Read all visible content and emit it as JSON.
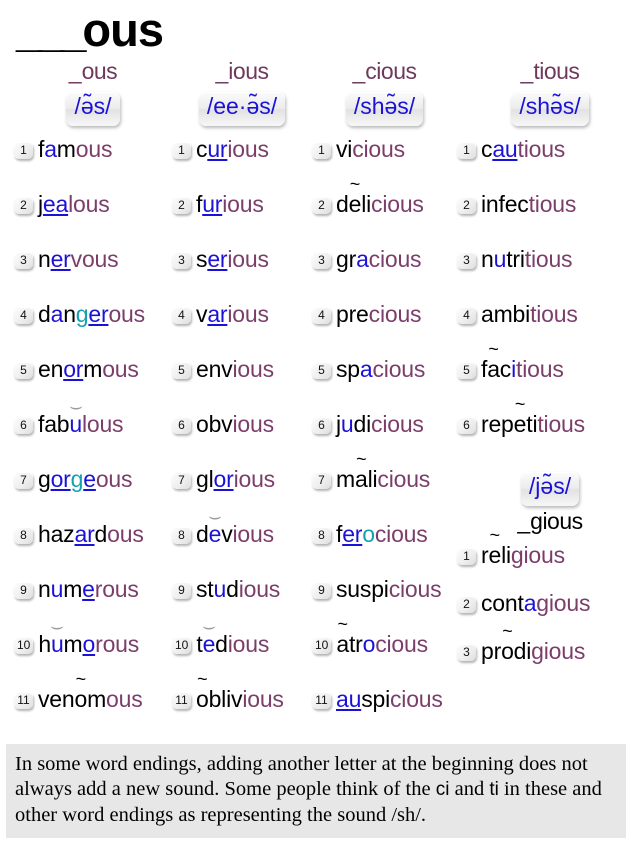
{
  "title": {
    "blank": "___",
    "suffix": "ous"
  },
  "columns": [
    {
      "id": "ous",
      "heading_blank": "_",
      "heading_suffix": "ous",
      "phonetic": "/ə̃s/",
      "words": [
        {
          "n": "1",
          "text": "famous"
        },
        {
          "n": "2",
          "text": "jealous"
        },
        {
          "n": "3",
          "text": "nervous"
        },
        {
          "n": "4",
          "text": "dangerous"
        },
        {
          "n": "5",
          "text": "enormous"
        },
        {
          "n": "6",
          "text": "fabulous"
        },
        {
          "n": "7",
          "text": "gorgeous"
        },
        {
          "n": "8",
          "text": "hazardous"
        },
        {
          "n": "9",
          "text": "numerous"
        },
        {
          "n": "10",
          "text": "humorous"
        },
        {
          "n": "11",
          "text": "venomous"
        }
      ]
    },
    {
      "id": "ious",
      "heading_blank": "_",
      "heading_suffix": "ious",
      "phonetic": "/ee·ə̃s/",
      "words": [
        {
          "n": "1",
          "text": "curious"
        },
        {
          "n": "2",
          "text": "furious"
        },
        {
          "n": "3",
          "text": "serious"
        },
        {
          "n": "4",
          "text": "various"
        },
        {
          "n": "5",
          "text": "envious"
        },
        {
          "n": "6",
          "text": "obvious"
        },
        {
          "n": "7",
          "text": "glorious"
        },
        {
          "n": "8",
          "text": "devious"
        },
        {
          "n": "9",
          "text": "studious"
        },
        {
          "n": "10",
          "text": "tedious"
        },
        {
          "n": "11",
          "text": "oblivious"
        }
      ]
    },
    {
      "id": "cious",
      "heading_blank": "_",
      "heading_suffix": "cious",
      "phonetic": "/shə̃s/",
      "words": [
        {
          "n": "1",
          "text": "vicious"
        },
        {
          "n": "2",
          "text": "delicious"
        },
        {
          "n": "3",
          "text": "gracious"
        },
        {
          "n": "4",
          "text": "precious"
        },
        {
          "n": "5",
          "text": "spacious"
        },
        {
          "n": "6",
          "text": "judicious"
        },
        {
          "n": "7",
          "text": "malicious"
        },
        {
          "n": "8",
          "text": "ferocious"
        },
        {
          "n": "9",
          "text": "suspicious"
        },
        {
          "n": "10",
          "text": "atrocious"
        },
        {
          "n": "11",
          "text": "auspicious"
        }
      ]
    },
    {
      "id": "tious",
      "heading_blank": "_",
      "heading_suffix": "tious",
      "phonetic": "/shə̃s/",
      "words": [
        {
          "n": "1",
          "text": "cautious"
        },
        {
          "n": "2",
          "text": "infectious"
        },
        {
          "n": "3",
          "text": "nutritious"
        },
        {
          "n": "4",
          "text": "ambitious"
        },
        {
          "n": "5",
          "text": "facitious"
        },
        {
          "n": "6",
          "text": "repetitious"
        }
      ]
    }
  ],
  "sub_group": {
    "id": "gious",
    "phonetic": "/jə̃s/",
    "heading_blank": "_",
    "heading_suffix": "gious",
    "words": [
      {
        "n": "1",
        "text": "religious"
      },
      {
        "n": "2",
        "text": "contagious"
      },
      {
        "n": "3",
        "text": "prodigious"
      }
    ]
  },
  "footer": {
    "text": "In some word endings, adding another letter at the beginning does not always add a new sound. Some people think of the ci and ti in these and other word endings as representing the sound /sh/."
  },
  "colors": {
    "heading": "#6d3a5e",
    "phonetic_text": "#1b12d8",
    "suffix_purple": "#7b3e6b",
    "vowel_blue": "#1b12d8",
    "soft_teal": "#13a3ae",
    "footer_bg": "#e7e7e7"
  },
  "word_markup": {
    "famous": "<span class='b'>f</span><span class='bl'>a</span><span class='b'>m</span><span class='pu'>ous</span>",
    "jealous": "<span class='b'>j</span><span class='bl u'>ea</span><span class='pu'>lous</span>",
    "nervous": "<span class='b'>n</span><span class='bl u'>er</span><span class='pu'>vous</span>",
    "dangerous": "<span class='b'>d</span><span class='bl'>a</span><span class='b'>n</span><span class='tl'>g</span><span class='bl u'>er</span><span class='pu'>ous</span>",
    "enormous": "<span class='b'>en</span><span class='bl u'>or</span><span class='b'>m</span><span class='pu'>ous</span>",
    "fabulous": "<span class='b'>fab</span><span class='bl br'>u</span><span class='pu'>lous</span>",
    "gorgeous": "<span class='b'>g</span><span class='bl u'>or</span><span class='tl u'>g</span><span class='bl u'>e</span><span class='pu'>ous</span>",
    "hazardous": "<span class='b'>haz</span><span class='bl u'>ar</span><span class='b'>d</span><span class='pu'>ous</span>",
    "numerous": "<span class='b'>n</span><span class='bl'>u</span><span class='b'>m</span><span class='bl u'>e</span><span class='pu'>rous</span>",
    "humorous": "<span class='b'>h</span><span class='bl br'>u</span><span class='b'>m</span><span class='bl u'>o</span><span class='pu'>rous</span>",
    "venomous": "<span class='b'>ven</span><span class='b tilde'>o</span><span class='b'>m</span><span class='pu'>ous</span>",
    "curious": "<span class='b'>c</span><span class='bl u'>ur</span><span class='pu'>ious</span>",
    "furious": "<span class='b'>f</span><span class='bl u'>ur</span><span class='pu'>ious</span>",
    "serious": "<span class='b'>s</span><span class='bl u'>er</span><span class='pu'>ious</span>",
    "various": "<span class='b'>v</span><span class='bl u'>ar</span><span class='pu'>ious</span>",
    "envious": "<span class='b'>env</span><span class='pu'>ious</span>",
    "obvious": "<span class='b'>obv</span><span class='pu'>ious</span>",
    "glorious": "<span class='b'>gl</span><span class='bl u'>or</span><span class='pu'>ious</span>",
    "devious": "<span class='b'>d</span><span class='bl br'>e</span><span class='b'>v</span><span class='pu'>ious</span>",
    "studious": "<span class='b'>st</span><span class='bl'>u</span><span class='b'>d</span><span class='pu'>ious</span>",
    "tedious": "<span class='b'>t</span><span class='bl br'>e</span><span class='b'>d</span><span class='pu'>ious</span>",
    "oblivious": "<span class='b tilde'>o</span><span class='b'>bliv</span><span class='pu'>ious</span>",
    "vicious": "<span class='b'>vi</span><span class='pu'>cious</span>",
    "delicious": "<span class='b'>d</span><span class='b tilde'>e</span><span class='b'>li</span><span class='pu'>cious</span>",
    "gracious": "<span class='b'>gr</span><span class='bl'>a</span><span class='pu'>cious</span>",
    "precious": "<span class='b'>pre</span><span class='pu'>cious</span>",
    "spacious": "<span class='b'>sp</span><span class='bl'>a</span><span class='pu'>cious</span>",
    "judicious": "<span class='b'>j</span><span class='bl'>u</span><span class='b'>di</span><span class='pu'>cious</span>",
    "malicious": "<span class='b'>m</span><span class='b tilde'>a</span><span class='b'>li</span><span class='pu'>cious</span>",
    "ferocious": "<span class='b'>f</span><span class='bl u'>er</span><span class='tl'>o</span><span class='pu'>cious</span>",
    "suspicious": "<span class='b'>suspi</span><span class='pu'>cious</span>",
    "atrocious": "<span class='b tilde'>a</span><span class='b'>tr</span><span class='bl'>o</span><span class='pu'>cious</span>",
    "auspicious": "<span class='bl u'>au</span><span class='b'>spi</span><span class='pu'>cious</span>",
    "cautious": "<span class='b'>c</span><span class='bl u'>au</span><span class='pu'>tious</span>",
    "infectious": "<span class='b'>infec</span><span class='pu'>tious</span>",
    "nutritious": "<span class='b'>n</span><span class='bl'>u</span><span class='b'>tri</span><span class='pu'>tious</span>",
    "ambitious": "<span class='b'>ambi</span><span class='pu'>tious</span>",
    "facitious": "<span class='b'>f</span><span class='b tilde'>a</span><span class='b'>c</span><span class='bl'>i</span><span class='pu'>tious</span>",
    "repetitious": "<span class='b'>rep</span><span class='b tilde'>e</span><span class='b'>ti</span><span class='pu'>tious</span>",
    "religious": "<span class='b'>r</span><span class='b tilde'>e</span><span class='b'>li</span><span class='pu'>gious</span>",
    "contagious": "<span class='b'>cont</span><span class='bl'>a</span><span class='pu'>gious</span>",
    "prodigious": "<span class='b'>pr</span><span class='b tilde'>o</span><span class='b'>di</span><span class='pu'>gious</span>"
  }
}
